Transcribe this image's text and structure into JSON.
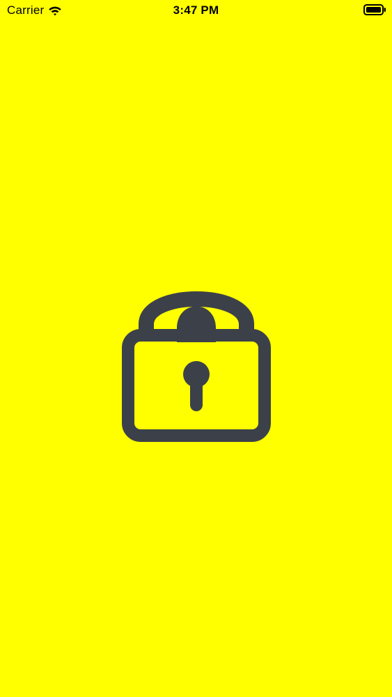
{
  "status_bar": {
    "carrier": "Carrier",
    "time": "3:47 PM",
    "icons": {
      "wifi": "wifi-icon",
      "battery": "battery-icon"
    }
  },
  "main": {
    "icon": "lock-icon",
    "icon_color": "#3C4149"
  },
  "colors": {
    "background": "#FFFF00",
    "status_text": "#000000"
  }
}
